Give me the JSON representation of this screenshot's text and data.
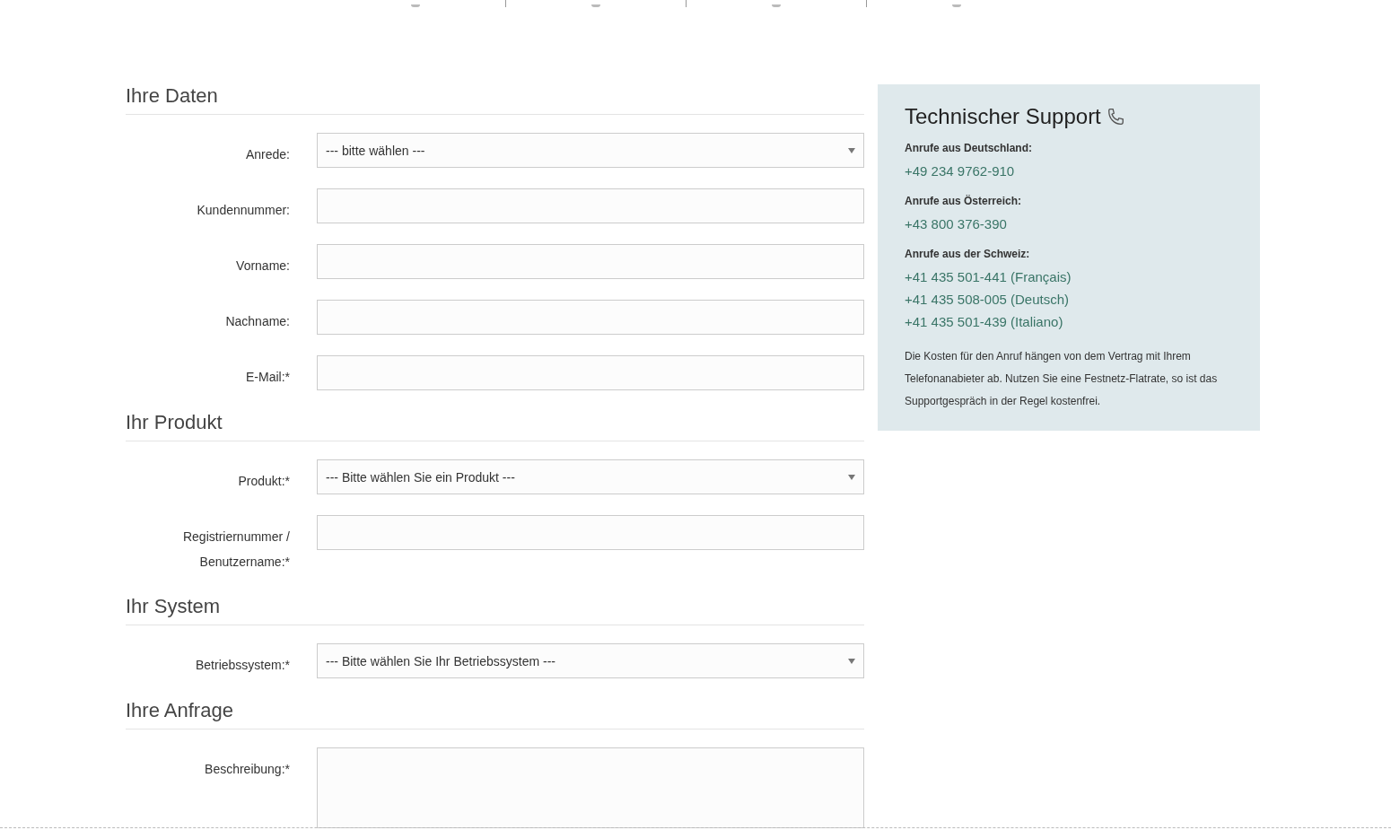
{
  "steps_bar": {
    "steps": [
      {
        "kind": "step"
      },
      {
        "kind": "step"
      },
      {
        "kind": "step"
      },
      {
        "kind": "step"
      }
    ]
  },
  "form": {
    "sections": [
      {
        "title": "Ihre Daten",
        "fields": [
          {
            "label": "Anrede:",
            "kind": "select",
            "value": "--- bitte wählen ---"
          },
          {
            "label": "Kundennummer:",
            "kind": "text"
          },
          {
            "label": "Vorname:",
            "kind": "text"
          },
          {
            "label": "Nachname:",
            "kind": "text"
          },
          {
            "label": "E-Mail:*",
            "kind": "text"
          }
        ]
      },
      {
        "title": "Ihr Produkt",
        "fields": [
          {
            "label": "Produkt:*",
            "kind": "select",
            "value": "--- Bitte wählen Sie ein Produkt ---"
          },
          {
            "label": "Registriernummer / Benutzername:*",
            "kind": "text"
          }
        ]
      },
      {
        "title": "Ihr System",
        "fields": [
          {
            "label": "Betriebssystem:*",
            "kind": "select",
            "value": "--- Bitte wählen Sie Ihr Betriebssystem ---"
          }
        ]
      },
      {
        "title": "Ihre Anfrage",
        "fields": [
          {
            "label": "Beschreibung:*",
            "kind": "textarea"
          }
        ]
      }
    ]
  },
  "support": {
    "title": "Technischer Support",
    "groups": [
      {
        "heading": "Anrufe aus Deutschland:",
        "numbers": [
          "+49 234 9762-910"
        ]
      },
      {
        "heading": "Anrufe aus Österreich:",
        "numbers": [
          "+43 800 376-390"
        ]
      },
      {
        "heading": "Anrufe aus der Schweiz:",
        "numbers": [
          "+41 435 501-441 (Français)",
          "+41 435 508-005 (Deutsch)",
          "+41 435 501-439 (Italiano)"
        ]
      }
    ],
    "note": "Die Kosten für den Anruf hängen von dem Vertrag mit Ihrem Telefonanabieter ab. Nutzen Sie eine Festnetz-Flatrate, so ist das Supportgespräch in der Regel kostenfrei."
  }
}
